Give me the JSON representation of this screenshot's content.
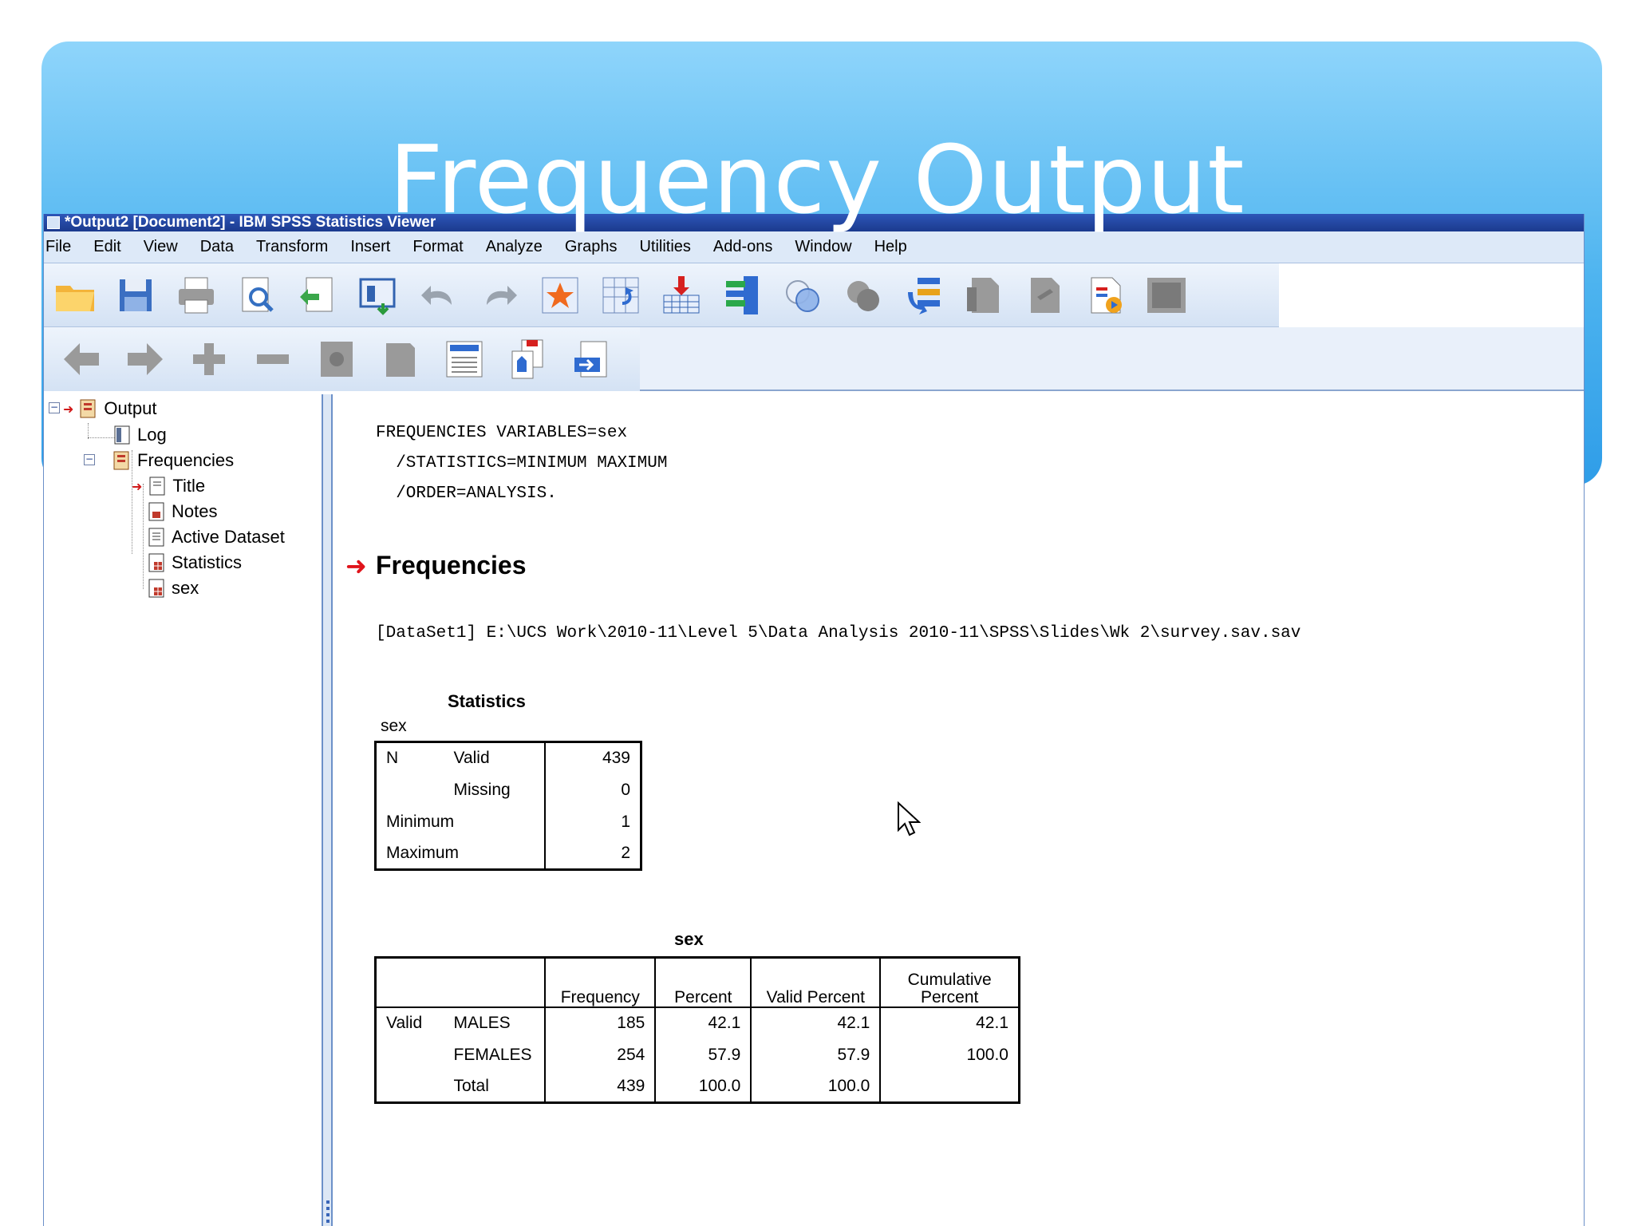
{
  "slide": {
    "title": "Frequency Output"
  },
  "window": {
    "title": "*Output2 [Document2] - IBM SPSS Statistics Viewer",
    "menu": [
      "File",
      "Edit",
      "View",
      "Data",
      "Transform",
      "Insert",
      "Format",
      "Analyze",
      "Graphs",
      "Utilities",
      "Add-ons",
      "Window",
      "Help"
    ]
  },
  "toolbar1": {
    "icons": [
      "open-folder-icon",
      "save-disk-icon",
      "print-icon",
      "print-preview-icon",
      "export-icon",
      "recall-dialog-icon",
      "undo-icon",
      "redo-icon",
      "goto-case-icon",
      "goto-variable-icon",
      "insert-cases-icon",
      "variables-icon",
      "split-file-icon",
      "weight-cases-icon",
      "designate-window-icon",
      "create-title-icon",
      "create-text-icon",
      "create-page-title-icon",
      "run-script-icon",
      "hide-icon"
    ]
  },
  "toolbar2": {
    "icons": [
      "promote-arrow-left-icon",
      "demote-arrow-right-icon",
      "expand-plus-icon",
      "collapse-minus-icon",
      "show-icon",
      "hide-items-icon",
      "insert-heading-icon",
      "insert-title-icon",
      "insert-text-icon"
    ]
  },
  "outline": {
    "root": "Output",
    "items": [
      {
        "label": "Log"
      },
      {
        "label": "Frequencies"
      },
      {
        "label": "Title"
      },
      {
        "label": "Notes"
      },
      {
        "label": "Active Dataset"
      },
      {
        "label": "Statistics"
      },
      {
        "label": "sex"
      }
    ]
  },
  "content": {
    "syntax_lines": [
      "FREQUENCIES VARIABLES=sex",
      "  /STATISTICS=MINIMUM MAXIMUM",
      "  /ORDER=ANALYSIS."
    ],
    "heading": "Frequencies",
    "dataset": "[DataSet1] E:\\UCS Work\\2010-11\\Level 5\\Data Analysis 2010-11\\SPSS\\Slides\\Wk 2\\survey.sav.sav"
  },
  "statistics_table": {
    "title": "Statistics",
    "variable": "sex",
    "rows": [
      {
        "c1": "N",
        "c2": "Valid",
        "value": "439"
      },
      {
        "c1": "",
        "c2": "Missing",
        "value": "0"
      },
      {
        "c1": "Minimum",
        "c2": "",
        "value": "1"
      },
      {
        "c1": "Maximum",
        "c2": "",
        "value": "2"
      }
    ]
  },
  "frequency_table": {
    "title": "sex",
    "headers": [
      "Frequency",
      "Percent",
      "Valid Percent",
      "Cumulative Percent"
    ],
    "rows": [
      {
        "group": "Valid",
        "label": "MALES",
        "frequency": "185",
        "percent": "42.1",
        "valid_percent": "42.1",
        "cumulative": "42.1"
      },
      {
        "group": "",
        "label": "FEMALES",
        "frequency": "254",
        "percent": "57.9",
        "valid_percent": "57.9",
        "cumulative": "100.0"
      },
      {
        "group": "",
        "label": "Total",
        "frequency": "439",
        "percent": "100.0",
        "valid_percent": "100.0",
        "cumulative": ""
      }
    ]
  },
  "colors": {
    "slide_band": "#4cb3ef",
    "titlebar": "#1b3a8e",
    "menubar": "#dde9f8",
    "accent_red": "#e0141b"
  }
}
